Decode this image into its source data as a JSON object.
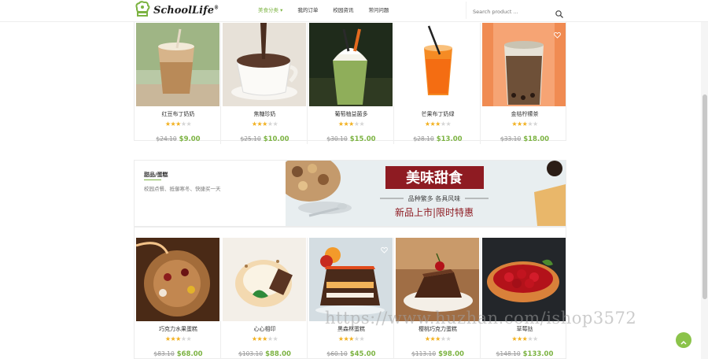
{
  "header": {
    "logo_text": "SchoolLife",
    "logo_reg": "®",
    "nav": [
      {
        "label": "美食分类",
        "active": true
      },
      {
        "label": "我的订单",
        "active": false
      },
      {
        "label": "校园资讯",
        "active": false
      },
      {
        "label": "常问问题",
        "active": false
      }
    ],
    "search_placeholder": "Search product ..."
  },
  "colors": {
    "accent": "#7cb342",
    "star": "#f2b01e",
    "old_price": "#999999"
  },
  "drinks": [
    {
      "name": "红豆布丁奶奶",
      "stars": 3,
      "old_price": "$24.10",
      "price": "$9.00"
    },
    {
      "name": "焦糖珍奶",
      "stars": 3,
      "old_price": "$25.10",
      "price": "$10.00"
    },
    {
      "name": "葡萄柚益菌多",
      "stars": 3,
      "old_price": "$30.10",
      "price": "$15.00"
    },
    {
      "name": "芒果布丁奶绿",
      "stars": 3,
      "old_price": "$28.10",
      "price": "$13.00"
    },
    {
      "name": "金桔柠檬茶",
      "stars": 3,
      "old_price": "$33.10",
      "price": "$18.00"
    }
  ],
  "banner": {
    "title": "甜品/蛋糕",
    "desc": "校园点餐、抵御寒冬、快捷买一天",
    "heading": "美味甜食",
    "line1": "品种繁多  各具风味",
    "line2": "新品上市|限时特惠"
  },
  "desserts": [
    {
      "name": "巧克力水果蛋糕",
      "stars": 3,
      "old_price": "$83.10",
      "price": "$68.00"
    },
    {
      "name": "心心相印",
      "stars": 3,
      "old_price": "$103.10",
      "price": "$88.00"
    },
    {
      "name": "黑森林蛋糕",
      "stars": 3,
      "old_price": "$60.10",
      "price": "$45.00"
    },
    {
      "name": "樱桃巧克力蛋糕",
      "stars": 3,
      "old_price": "$113.10",
      "price": "$98.00"
    },
    {
      "name": "草莓挞",
      "stars": 3,
      "old_price": "$148.10",
      "price": "$133.00"
    }
  ],
  "watermark": "https://www.huzhan.com/ishop3572"
}
